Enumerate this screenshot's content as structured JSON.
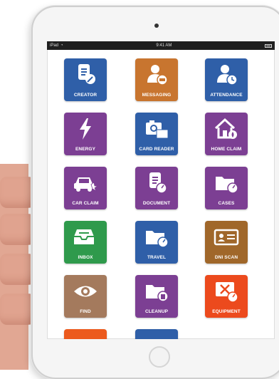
{
  "status_bar": {
    "device": "iPad",
    "time": "9:41 AM"
  },
  "apps": [
    {
      "label": "CREATOR",
      "icon": "document-edit-icon",
      "color": "#2f5fa8"
    },
    {
      "label": "MESSAGING",
      "icon": "person-message-icon",
      "color": "#c8752f"
    },
    {
      "label": "ATTENDANCE",
      "icon": "person-clock-icon",
      "color": "#2f5fa8"
    },
    {
      "label": "ENERGY",
      "icon": "lightning-icon",
      "color": "#7c3f93"
    },
    {
      "label": "CARD READER",
      "icon": "camera-card-icon",
      "color": "#2f5fa8"
    },
    {
      "label": "HOME CLAIM",
      "icon": "house-fire-icon",
      "color": "#7c3f93"
    },
    {
      "label": "CAR CLAIM",
      "icon": "car-crash-icon",
      "color": "#7c3f93"
    },
    {
      "label": "DOCUMENT",
      "icon": "document-gauge-icon",
      "color": "#7c3f93"
    },
    {
      "label": "CASES",
      "icon": "folder-gauge-icon",
      "color": "#7c3f93"
    },
    {
      "label": "INBOX",
      "icon": "inbox-tray-icon",
      "color": "#2f9a4c"
    },
    {
      "label": "TRAVEL",
      "icon": "folder-gauge-icon",
      "color": "#2f5fa8"
    },
    {
      "label": "DNI SCAN",
      "icon": "id-card-icon",
      "color": "#a0672a"
    },
    {
      "label": "FIND",
      "icon": "eye-icon",
      "color": "#a47a5d"
    },
    {
      "label": "CLEANUP",
      "icon": "folder-trash-icon",
      "color": "#7c3f93"
    },
    {
      "label": "EQUIPMENT",
      "icon": "tools-gauge-icon",
      "color": "#ec4a1d"
    }
  ]
}
